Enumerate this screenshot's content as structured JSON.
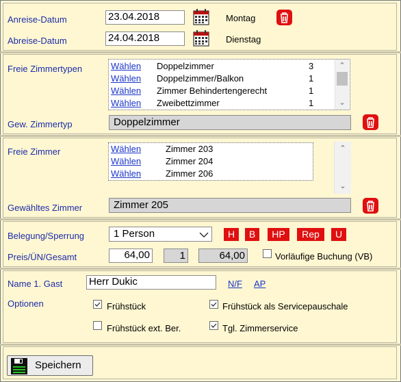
{
  "dates": {
    "arrival_label": "Anreise-Datum",
    "arrival_value": "23.04.2018",
    "arrival_day": "Montag",
    "departure_label": "Abreise-Datum",
    "departure_value": "24.04.2018",
    "departure_day": "Dienstag"
  },
  "room_types": {
    "label": "Freie Zimmertypen",
    "choose_label": "Wählen",
    "items": [
      {
        "name": "Doppelzimmer",
        "count": "3"
      },
      {
        "name": "Doppelzimmer/Balkon",
        "count": "1"
      },
      {
        "name": "Zimmer Behindertengerecht",
        "count": "1"
      },
      {
        "name": "Zweibettzimmer",
        "count": "1"
      }
    ],
    "selected_label": "Gew. Zimmertyp",
    "selected_value": "Doppelzimmer"
  },
  "rooms": {
    "label": "Freie Zimmer",
    "choose_label": "Wählen",
    "items": [
      {
        "name": "Zimmer 203"
      },
      {
        "name": "Zimmer 204"
      },
      {
        "name": "Zimmer 206"
      }
    ],
    "selected_label": "Gewähltes Zimmer",
    "selected_value": "Zimmer 205"
  },
  "booking": {
    "occupancy_label": "Belegung/Sperrung",
    "occupancy_value": "1 Person",
    "badges": [
      "H",
      "B",
      "HP",
      "Rep",
      "U"
    ],
    "price_label": "Preis/ÜN/Gesamt",
    "price_per_night": "64,00",
    "nights": "1",
    "total": "64,00",
    "provisional_label": "Vorläufige Buchung (VB)",
    "provisional_checked": false
  },
  "guest": {
    "name_label": "Name 1. Gast",
    "name_value": "Herr Dukic",
    "link_nf": "N/F",
    "link_ap": "AP",
    "options_label": "Optionen",
    "options": [
      {
        "label": "Frühstück",
        "checked": true
      },
      {
        "label": "Frühstück als Servicepauschale",
        "checked": true
      },
      {
        "label": "Frühstück ext. Ber.",
        "checked": false
      },
      {
        "label": "Tgl. Zimmerservice",
        "checked": true
      }
    ]
  },
  "footer": {
    "save_label": "Speichern"
  },
  "colors": {
    "background": "#fef7d2",
    "label": "#1c2ca8",
    "accent_red": "#e01010",
    "link": "#1a35c8"
  }
}
